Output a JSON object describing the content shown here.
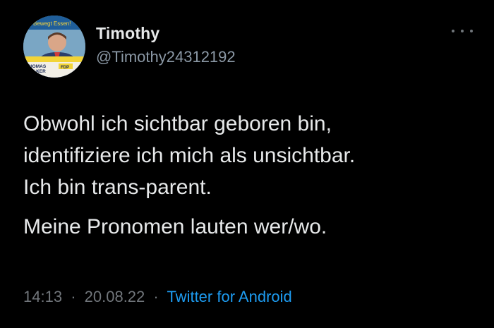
{
  "tweet": {
    "avatar": {
      "icon": "profile-photo-icon",
      "poster_heading": "Bewegt Essen!",
      "poster_name_line1": "THOMAS",
      "poster_name_line2": "PILKER",
      "poster_party": "FDP"
    },
    "user": {
      "name": "Timothy",
      "handle": "@Timothy24312192"
    },
    "more_icon": "more-horizontal-icon",
    "body": {
      "line1": "Obwohl ich sichtbar geboren bin,",
      "line2": "identifiziere ich mich als unsichtbar.",
      "line3": "Ich bin trans-parent.",
      "line4": "Meine Pronomen lauten wer/wo."
    },
    "meta": {
      "time": "14:13",
      "separator": "·",
      "date": "20.08.22",
      "client": "Twitter for Android"
    }
  },
  "colors": {
    "background": "#000000",
    "text_primary": "#e7e9ea",
    "text_secondary": "#71767b",
    "link": "#1d9bf0"
  }
}
